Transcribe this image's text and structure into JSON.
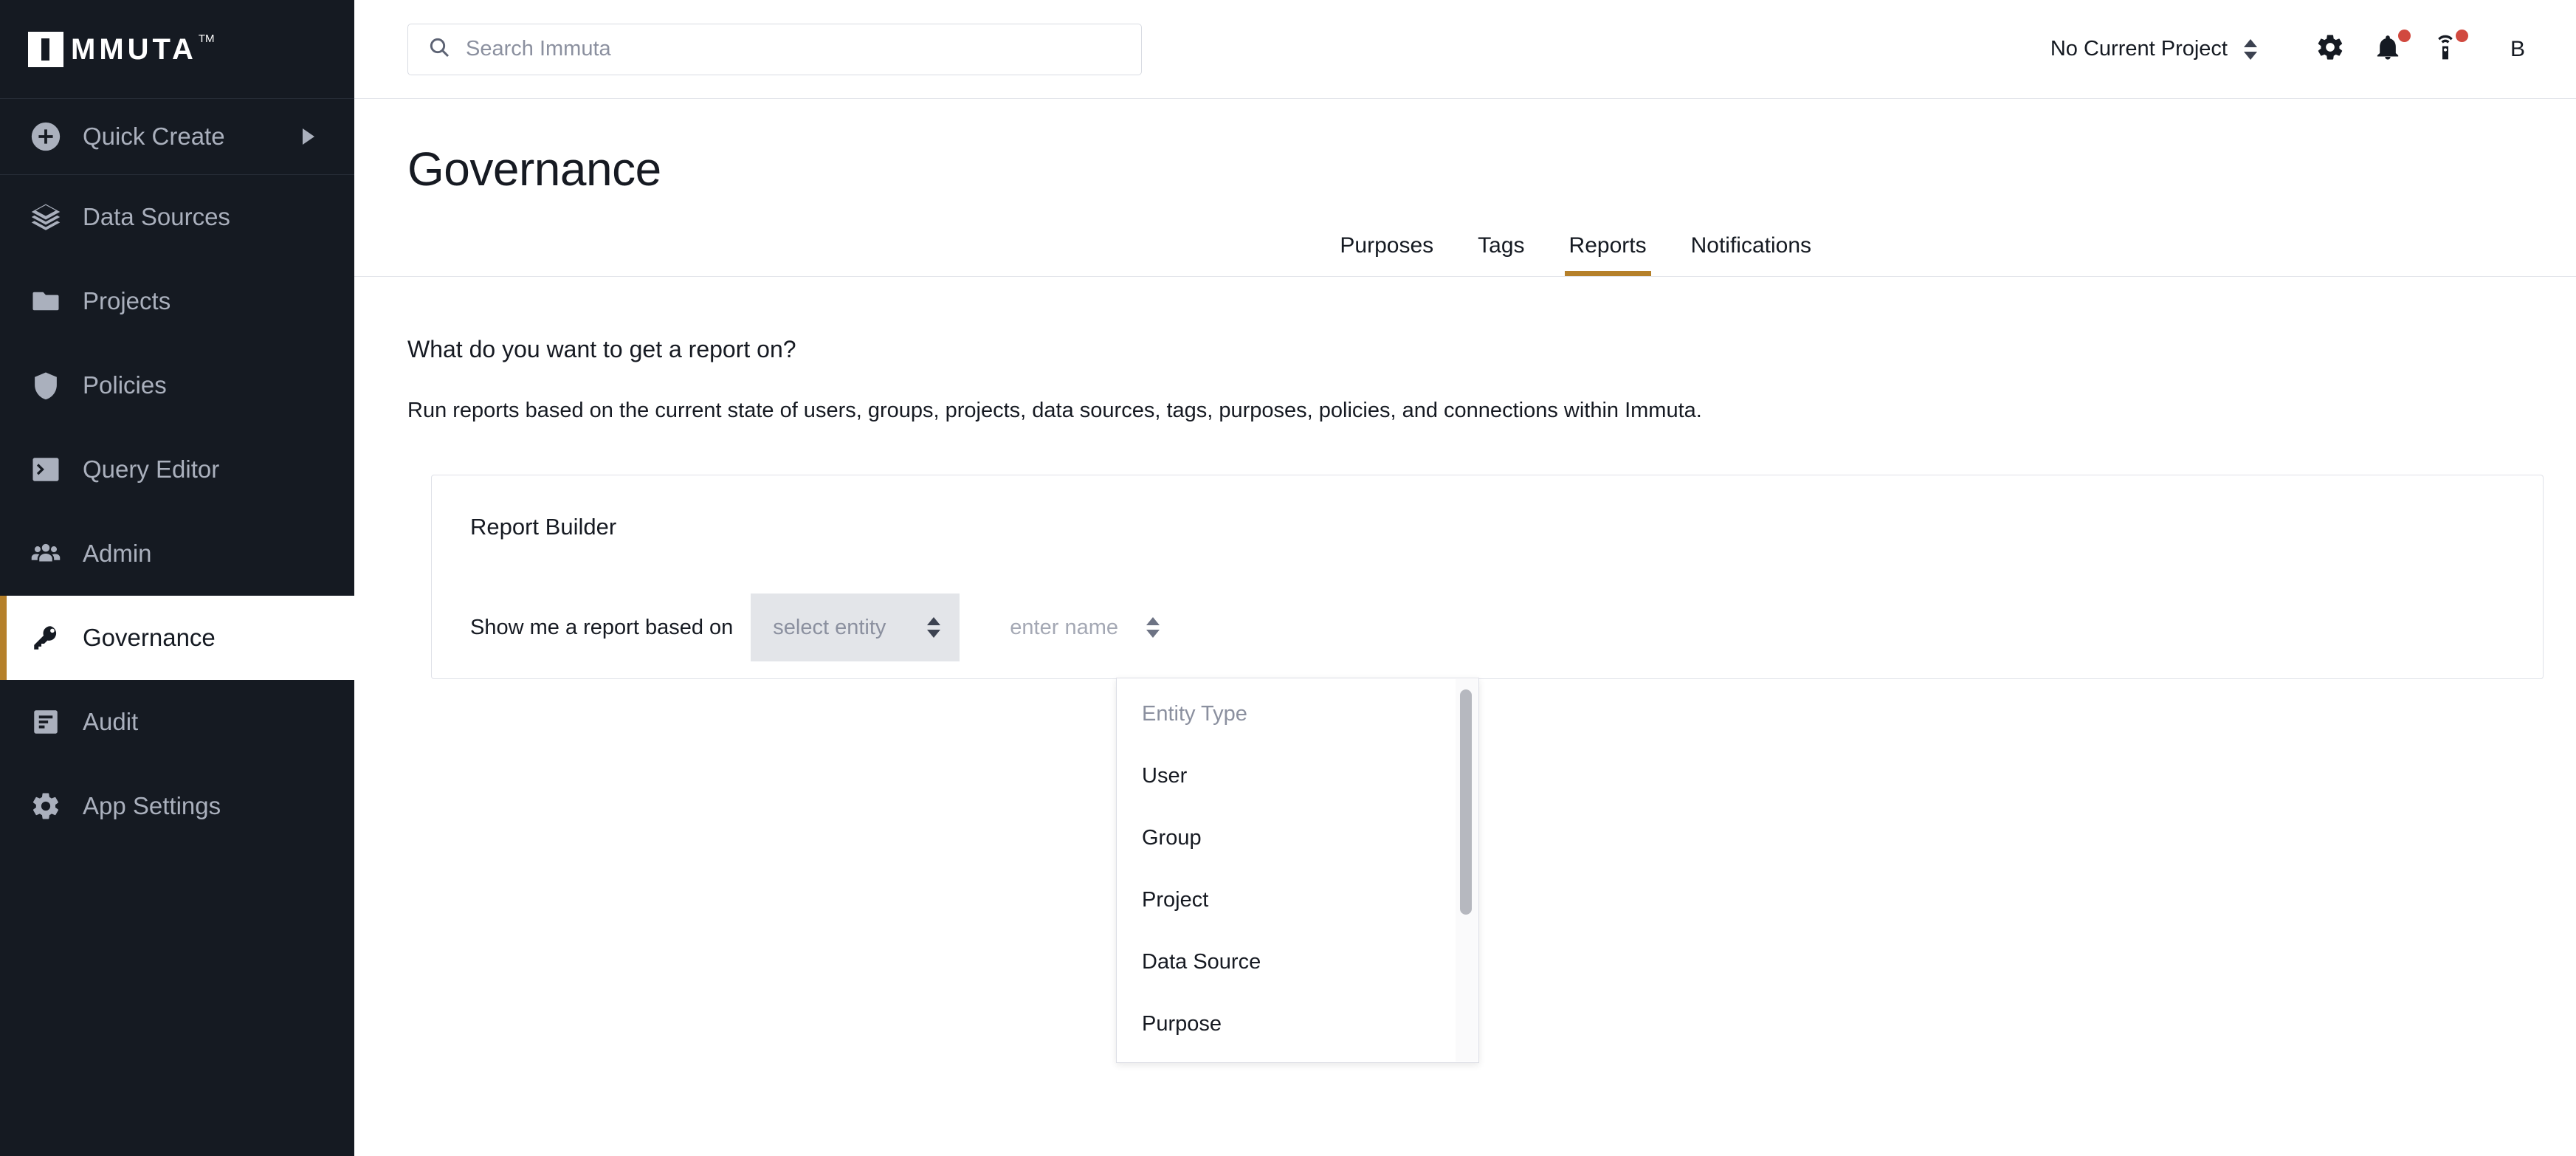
{
  "sidebar": {
    "logo": {
      "text": "MMUTA",
      "tm": "TM",
      "alt": "Immuta"
    },
    "quick_create": {
      "label": "Quick Create",
      "icon": "plus-circle-icon"
    },
    "items": [
      {
        "label": "Data Sources",
        "icon": "layers-icon",
        "active": false
      },
      {
        "label": "Projects",
        "icon": "folder-icon",
        "active": false
      },
      {
        "label": "Policies",
        "icon": "shield-icon",
        "active": false
      },
      {
        "label": "Query Editor",
        "icon": "terminal-icon",
        "active": false
      },
      {
        "label": "Admin",
        "icon": "users-icon",
        "active": false
      },
      {
        "label": "Governance",
        "icon": "key-icon",
        "active": true
      },
      {
        "label": "Audit",
        "icon": "audit-list-icon",
        "active": false
      },
      {
        "label": "App Settings",
        "icon": "gear-icon",
        "active": false
      }
    ]
  },
  "topbar": {
    "search": {
      "placeholder": "Search Immuta",
      "icon": "search-icon"
    },
    "project_selector": {
      "label": "No Current Project",
      "icon": "up-down-chevron-icon"
    },
    "settings_icon": "gear-icon",
    "notifications_icon": "bell-icon",
    "broadcast_icon": "broadcast-icon",
    "avatar_initial": "B",
    "badge_color": "#d1493f"
  },
  "page": {
    "title": "Governance",
    "accent_color": "#b5802a",
    "tabs": [
      {
        "label": "Purposes",
        "active": false
      },
      {
        "label": "Tags",
        "active": false
      },
      {
        "label": "Reports",
        "active": true
      },
      {
        "label": "Notifications",
        "active": false
      }
    ]
  },
  "content": {
    "question": "What do you want to get a report on?",
    "description": "Run reports based on the current state of users, groups, projects, data sources, tags, purposes, policies, and connections within Immuta."
  },
  "report_builder": {
    "card_title": "Report Builder",
    "row_label": "Show me a report based on",
    "entity_select": {
      "value": "select entity",
      "placeholder": "select entity"
    },
    "name_select": {
      "value": "enter name",
      "placeholder": "enter name"
    }
  },
  "entity_dropdown": {
    "open": true,
    "header": "Entity Type",
    "options": [
      {
        "label": "User"
      },
      {
        "label": "Group"
      },
      {
        "label": "Project"
      },
      {
        "label": "Data Source"
      },
      {
        "label": "Purpose"
      }
    ]
  }
}
